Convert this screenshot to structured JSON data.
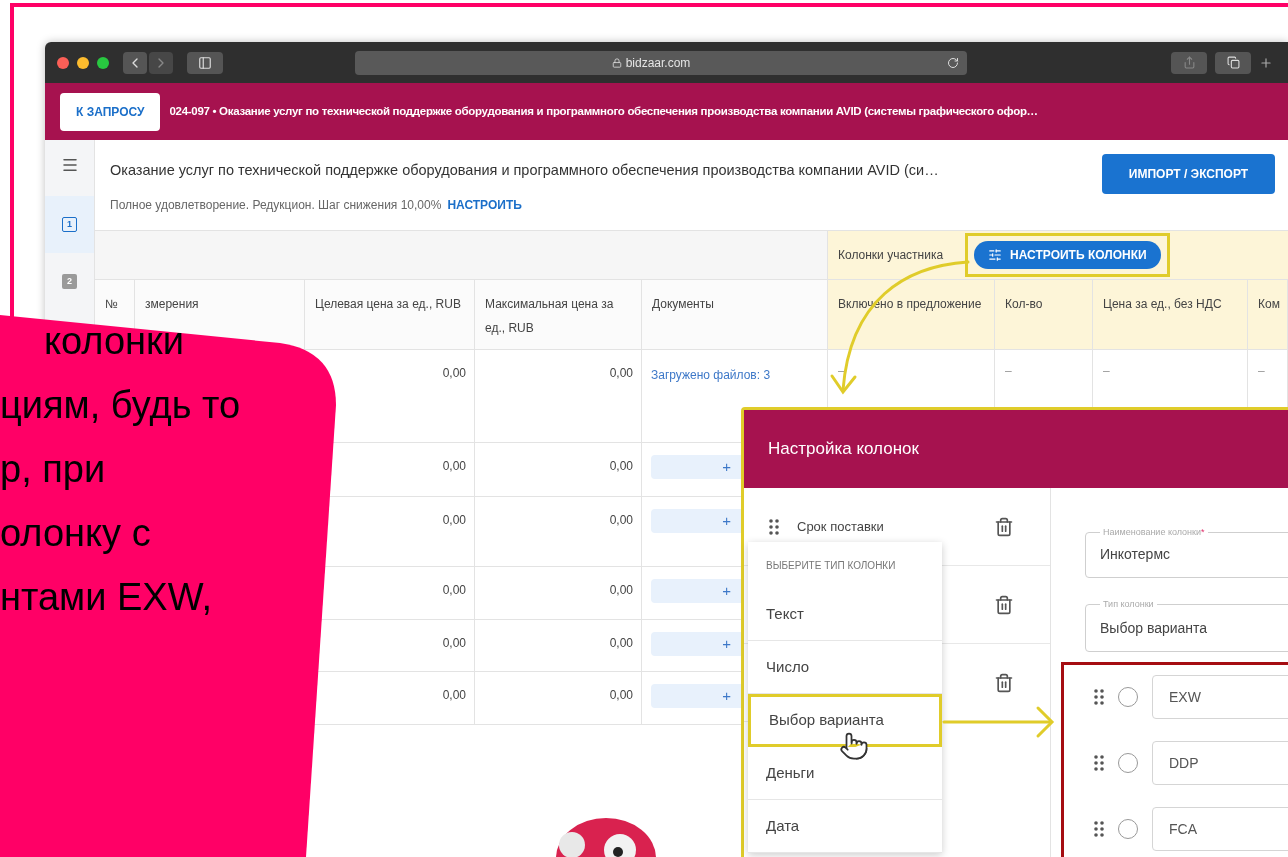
{
  "callout": {
    "lines": [
      "колонки",
      "циям, будь то",
      "р, при",
      "олонку с",
      "нтами EXW,"
    ]
  },
  "browser": {
    "url": "bidzaar.com"
  },
  "topbar": {
    "back_button": "К ЗАПРОСУ",
    "title": "024-097 • Оказание услуг по технической поддержке оборудования и программного обеспечения производства компании AVID (системы графического офор…"
  },
  "rail": {
    "steps": [
      {
        "label": "1",
        "selected": true
      },
      {
        "label": "2",
        "selected": false
      }
    ]
  },
  "header": {
    "title": "Оказание услуг по технической поддержке оборудования и программного обеспечения производства компании AVID (си…",
    "subtitle": "Полное удовлетворение. Редукцион. Шаг снижения 10,00%",
    "subtitle_link": "НАСТРОИТЬ",
    "button": "ИМПОРТ / ЭКСПОРТ"
  },
  "table": {
    "group_label": "Колонки участника",
    "group_button": "НАСТРОИТЬ КОЛОНКИ",
    "columns": [
      "№",
      "змерения",
      "Целевая цена за ед., RUB",
      "Максимальная цена за ед., RUB",
      "Документы",
      "Включено в предложение",
      "Кол-во",
      "Цена за ед., без НДС",
      "Ком"
    ],
    "rows": [
      {
        "target": "0,00",
        "max": "0,00",
        "documents": {
          "kind": "link",
          "text": "Загружено файлов: 3"
        },
        "participant": [
          "–",
          "–",
          "–",
          "–"
        ]
      },
      {
        "target": "0,00",
        "max": "0,00",
        "documents": {
          "kind": "add",
          "text": "+"
        }
      },
      {
        "target": "0,00",
        "max": "0,00",
        "documents": {
          "kind": "add",
          "text": "+"
        }
      },
      {
        "target": "0,00",
        "max": "0,00",
        "documents": {
          "kind": "add",
          "text": "+"
        }
      },
      {
        "target": "0,00",
        "max": "0,00",
        "documents": {
          "kind": "add",
          "text": "+"
        }
      },
      {
        "target": "0,00",
        "max": "0,00",
        "documents": {
          "kind": "add",
          "text": "+"
        }
      }
    ]
  },
  "dialog": {
    "title": "Настройка колонок",
    "columns": [
      {
        "label": "Срок поставки"
      },
      {},
      {}
    ],
    "type_menu": {
      "heading": "ВЫБЕРИТЕ ТИП КОЛОНКИ",
      "items": [
        {
          "label": "Текст",
          "selected": false
        },
        {
          "label": "Число",
          "selected": false
        },
        {
          "label": "Выбор варианта",
          "selected": true
        },
        {
          "label": "Деньги",
          "selected": false
        },
        {
          "label": "Дата",
          "selected": false
        }
      ]
    },
    "name_field": {
      "label": "Наименование колонки",
      "required_mark": "*",
      "value": "Инкотермс"
    },
    "type_field": {
      "label": "Тип колонки",
      "value": "Выбор варианта"
    },
    "options": [
      {
        "value": "EXW",
        "checked": false
      },
      {
        "value": "DDP",
        "checked": false
      },
      {
        "value": "FCA",
        "checked": false
      }
    ]
  }
}
